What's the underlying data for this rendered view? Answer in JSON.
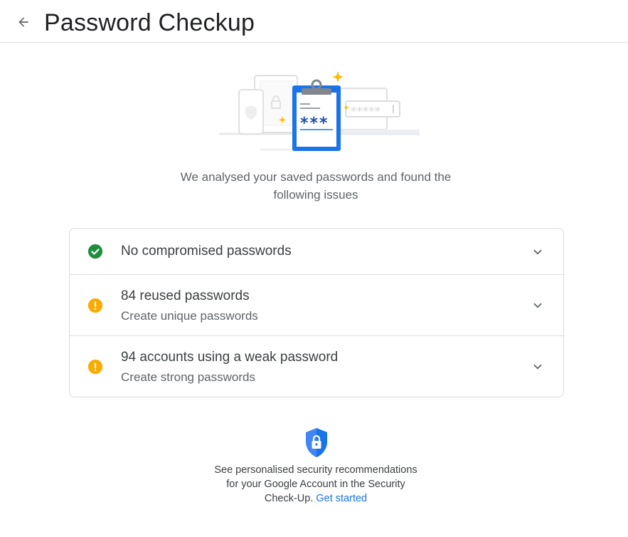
{
  "header": {
    "title": "Password Checkup",
    "back_icon": "arrow-back-icon"
  },
  "hero": {
    "illustration_icon": "password-checkup-illustration",
    "mask_short": "***",
    "mask_long": "*****"
  },
  "intro": {
    "text": "We analysed your saved passwords and found the following issues"
  },
  "issues": [
    {
      "icon": "check-circle-icon",
      "status_color": "#1e8e3e",
      "title": "No compromised passwords",
      "subtitle": ""
    },
    {
      "icon": "warning-circle-icon",
      "status_color": "#f9ab00",
      "title": "84 reused passwords",
      "subtitle": "Create unique passwords"
    },
    {
      "icon": "warning-circle-icon",
      "status_color": "#f9ab00",
      "title": "94 accounts using a weak password",
      "subtitle": "Create strong passwords"
    }
  ],
  "footer": {
    "shield_icon": "shield-lock-icon",
    "text": "See personalised security recommendations for your Google Account in the Security Check-Up.",
    "link_text": "Get started",
    "link_color": "#1a73e8"
  },
  "colors": {
    "accent_blue": "#1a73e8",
    "ok_green": "#1e8e3e",
    "warning_yellow": "#f9ab00",
    "divider": "#dadce0"
  }
}
